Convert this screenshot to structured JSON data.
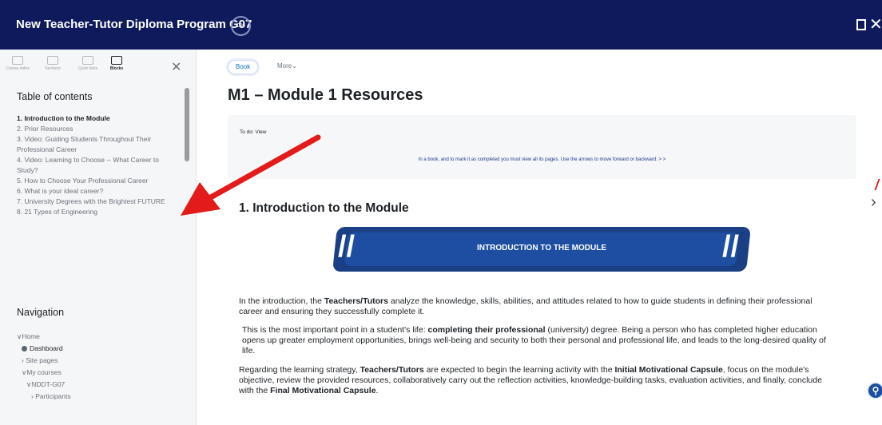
{
  "header": {
    "title": "New Teacher-Tutor Diploma Program G07",
    "progress_label": "0%"
  },
  "drawer": {
    "tabs": [
      {
        "label": "Course index",
        "active": false
      },
      {
        "label": "Sections",
        "active": false
      },
      {
        "label": "Quick links",
        "active": false
      },
      {
        "label": "Blocks",
        "active": true
      }
    ],
    "toc_title": "Table of contents",
    "toc": [
      {
        "label": "1. Introduction to the Module",
        "active": true
      },
      {
        "label": "2. Prior Resources",
        "active": false
      },
      {
        "label": "3. Video: Guiding Students Throughout Their Professional Career",
        "active": false
      },
      {
        "label": "4. Video: Learning to Choose -- What Career to Study?",
        "active": false
      },
      {
        "label": "5. How to Choose Your Professional Career",
        "active": false
      },
      {
        "label": "6. What is your ideal career?",
        "active": false
      },
      {
        "label": "7. University Degrees with the Brightest FUTURE",
        "active": false
      },
      {
        "label": "8. 21 Types of Engineering",
        "active": false
      }
    ],
    "nav_title": "Navigation",
    "nav": {
      "home": "Home",
      "dashboard": "Dashboard",
      "site_pages": "Site pages",
      "my_courses": "My courses",
      "course": "NDDT-G07",
      "participants": "Participants"
    }
  },
  "main": {
    "book_button": "Book",
    "more_button": "More",
    "page_title": "M1 – Module 1 Resources",
    "todo_label": "To do: View",
    "todo_hint": "In a book, and to mark it as completed you must view all its pages. Use the arrows to move forward or backward. > >",
    "section_title": "1. Introduction to the Module",
    "banner_text": "INTRODUCTION TO THE MODULE",
    "paragraphs": {
      "p1_a": "In the introduction, the ",
      "p1_b": "Teachers/Tutors",
      "p1_c": " analyze the knowledge, skills, abilities, and attitudes related to how to guide students in defining their professional career and ensuring they successfully complete it.",
      "p2_a": "This is the most important point in a student's life: ",
      "p2_b": "completing their professional",
      "p2_c": " (university) degree. Being a person who has completed higher education opens up greater employment opportunities, brings well-being and security to both their personal and professional life, and leads to the long-desired quality of life.",
      "p3_a": "Regarding the learning strategy, ",
      "p3_b": "Teachers/Tutors",
      "p3_c": " are expected to begin the learning activity with the ",
      "p3_d": "Initial Motivational Capsule",
      "p3_e": ", focus on the module's objective, review the provided resources, collaboratively carry out the reflection activities, knowledge-building tasks, evaluation activities, and finally, conclude with the ",
      "p3_f": "Final Motivational Capsule",
      "p3_g": "."
    }
  },
  "colors": {
    "header_bg": "#0f1a5c",
    "accent": "#0f6cbf",
    "banner": "#1d4ea1",
    "annotation_red": "#e31b1b"
  },
  "icons": [
    "document-icon",
    "close-icon",
    "chevron-right-icon",
    "accessibility-icon"
  ]
}
